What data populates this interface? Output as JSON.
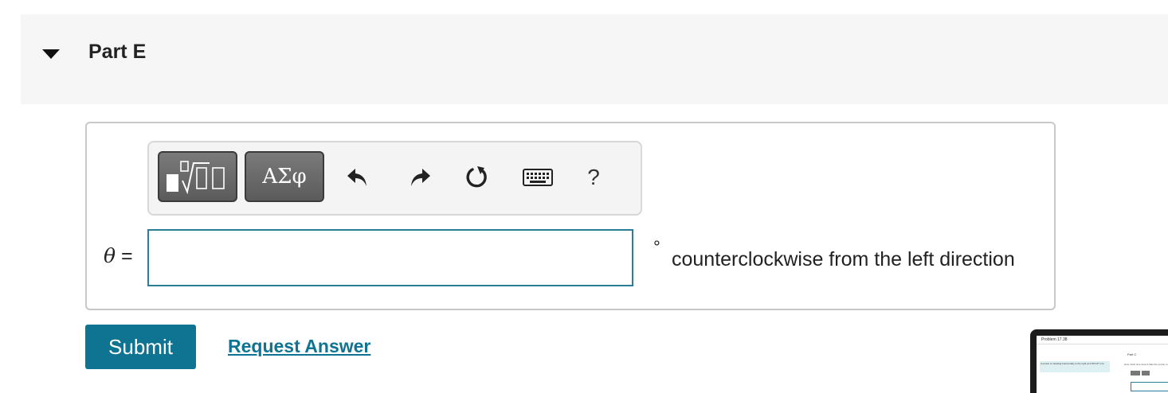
{
  "part": {
    "title": "Part E"
  },
  "toolbar": {
    "templates_icon": "templates-icon",
    "symbols_label": "ΑΣφ",
    "undo_icon": "undo-icon",
    "redo_icon": "redo-icon",
    "reset_icon": "reset-icon",
    "keyboard_icon": "keyboard-icon",
    "help_label": "?"
  },
  "answer": {
    "variable": "θ",
    "equals": "=",
    "value": "",
    "degree_symbol": "°",
    "unit_text": "counterclockwise from the left direction"
  },
  "actions": {
    "submit_label": "Submit",
    "request_answer_label": "Request Answer"
  },
  "thumbnail": {
    "title": "Problem 17.38",
    "part": "Part C",
    "left_text": "A proton is traveling horizontally to the right at 4.50×10⁶ m/s.",
    "question": "How much time does it take the proton to"
  },
  "colors": {
    "accent": "#0e7492",
    "header_bg": "#f6f6f6",
    "input_border": "#2a7f96"
  }
}
